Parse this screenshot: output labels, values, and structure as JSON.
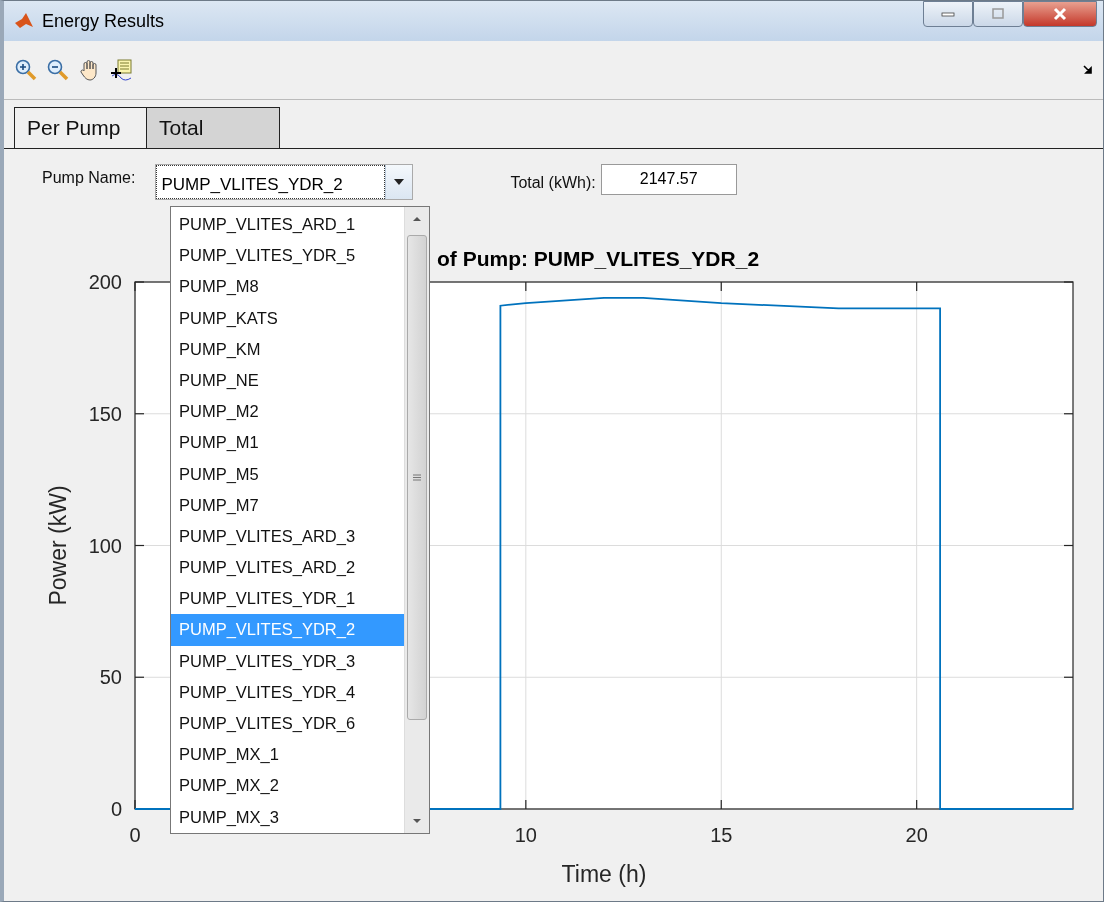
{
  "window": {
    "title": "Energy Results"
  },
  "tabs": [
    {
      "label": "Per Pump",
      "selected": true
    },
    {
      "label": "Total",
      "selected": false
    }
  ],
  "pump_selector": {
    "label": "Pump Name:",
    "value": "PUMP_VLITES_YDR_2"
  },
  "total": {
    "label": "Total (kWh):",
    "value": "2147.57"
  },
  "dropdown": {
    "items": [
      {
        "label": "PUMP_VLITES_ARD_1",
        "selected": false
      },
      {
        "label": "PUMP_VLITES_YDR_5",
        "selected": false
      },
      {
        "label": "PUMP_M8",
        "selected": false
      },
      {
        "label": "PUMP_KATS",
        "selected": false
      },
      {
        "label": "PUMP_KM",
        "selected": false
      },
      {
        "label": "PUMP_NE",
        "selected": false
      },
      {
        "label": "PUMP_M2",
        "selected": false
      },
      {
        "label": "PUMP_M1",
        "selected": false
      },
      {
        "label": "PUMP_M5",
        "selected": false
      },
      {
        "label": "PUMP_M7",
        "selected": false
      },
      {
        "label": "PUMP_VLITES_ARD_3",
        "selected": false
      },
      {
        "label": "PUMP_VLITES_ARD_2",
        "selected": false
      },
      {
        "label": "PUMP_VLITES_YDR_1",
        "selected": false
      },
      {
        "label": "PUMP_VLITES_YDR_2",
        "selected": true
      },
      {
        "label": "PUMP_VLITES_YDR_3",
        "selected": false
      },
      {
        "label": "PUMP_VLITES_YDR_4",
        "selected": false
      },
      {
        "label": "PUMP_VLITES_YDR_6",
        "selected": false
      },
      {
        "label": "PUMP_MX_1",
        "selected": false
      },
      {
        "label": "PUMP_MX_2",
        "selected": false
      },
      {
        "label": "PUMP_MX_3",
        "selected": false
      }
    ]
  },
  "chart_data": {
    "type": "line",
    "title": "of Pump: PUMP_VLITES_YDR_2",
    "xlabel": "Time (h)",
    "ylabel": "Power (kW)",
    "xlim": [
      0,
      24
    ],
    "ylim": [
      0,
      200
    ],
    "xticks": [
      0,
      10,
      15,
      20
    ],
    "yticks": [
      0,
      50,
      100,
      150,
      200
    ],
    "x": [
      0,
      9.35,
      9.35,
      10,
      12,
      13,
      15,
      18,
      20.6,
      20.6,
      24
    ],
    "grid": true,
    "series": [
      {
        "color": "#0072bd",
        "values": [
          0,
          0,
          191,
          192,
          194,
          194,
          192,
          190,
          190,
          0,
          0
        ]
      }
    ]
  }
}
